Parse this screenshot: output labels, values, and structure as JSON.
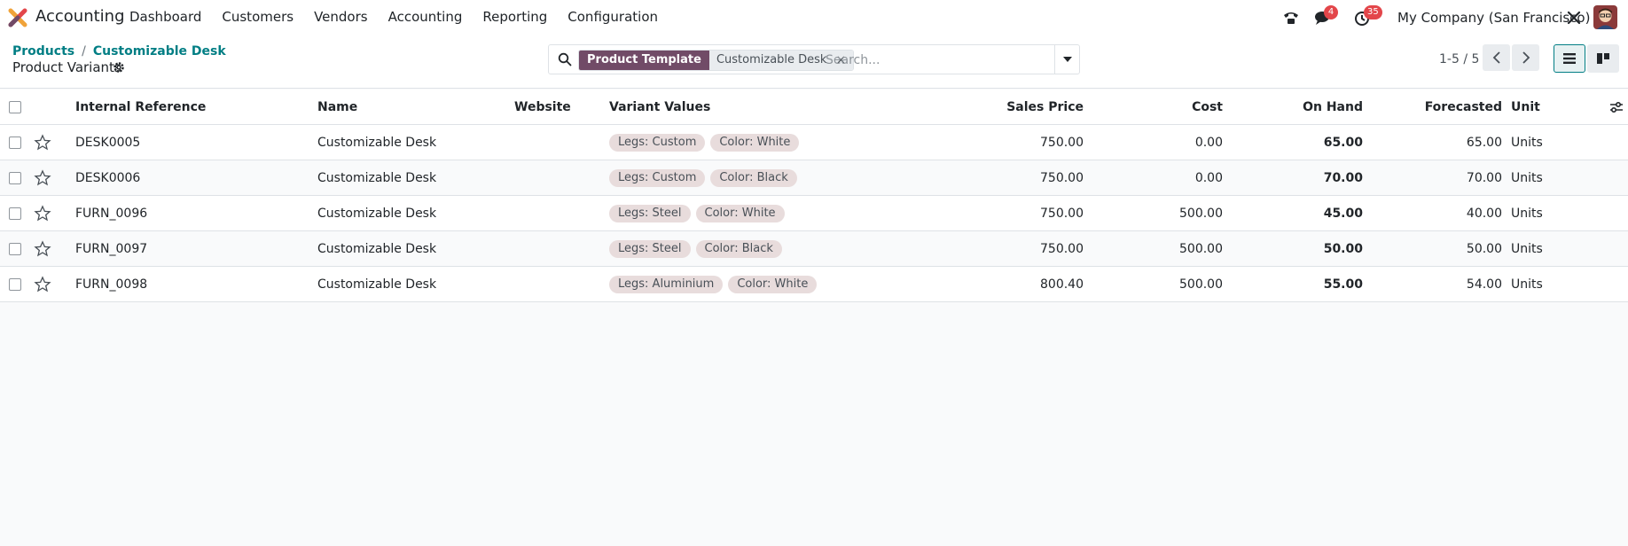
{
  "app": {
    "name": "Accounting"
  },
  "menu": [
    "Dashboard",
    "Customers",
    "Vendors",
    "Accounting",
    "Reporting",
    "Configuration"
  ],
  "systray": {
    "messages_count": "4",
    "activities_count": "35",
    "company": "My Company (San Francisco)"
  },
  "breadcrumb": {
    "parent": "Products",
    "current": "Customizable Desk",
    "separator": "/"
  },
  "page_title": "Product Variants",
  "search": {
    "facet_label": "Product Template",
    "facet_value": "Customizable Desk",
    "remove_symbol": "×",
    "placeholder": "Search..."
  },
  "pager": {
    "text": "1-5 / 5"
  },
  "table": {
    "headers": {
      "internal_ref": "Internal Reference",
      "name": "Name",
      "website": "Website",
      "variant_values": "Variant Values",
      "sales_price": "Sales Price",
      "cost": "Cost",
      "on_hand": "On Hand",
      "forecasted": "Forecasted",
      "unit": "Unit"
    },
    "rows": [
      {
        "ref": "DESK0005",
        "name": "Customizable Desk",
        "tags": [
          "Legs: Custom",
          "Color: White"
        ],
        "price": "750.00",
        "cost": "0.00",
        "on_hand": "65.00",
        "forecasted": "65.00",
        "unit": "Units"
      },
      {
        "ref": "DESK0006",
        "name": "Customizable Desk",
        "tags": [
          "Legs: Custom",
          "Color: Black"
        ],
        "price": "750.00",
        "cost": "0.00",
        "on_hand": "70.00",
        "forecasted": "70.00",
        "unit": "Units"
      },
      {
        "ref": "FURN_0096",
        "name": "Customizable Desk",
        "tags": [
          "Legs: Steel",
          "Color: White"
        ],
        "price": "750.00",
        "cost": "500.00",
        "on_hand": "45.00",
        "forecasted": "40.00",
        "unit": "Units"
      },
      {
        "ref": "FURN_0097",
        "name": "Customizable Desk",
        "tags": [
          "Legs: Steel",
          "Color: Black"
        ],
        "price": "750.00",
        "cost": "500.00",
        "on_hand": "50.00",
        "forecasted": "50.00",
        "unit": "Units"
      },
      {
        "ref": "FURN_0098",
        "name": "Customizable Desk",
        "tags": [
          "Legs: Aluminium",
          "Color: White"
        ],
        "price": "800.40",
        "cost": "500.00",
        "on_hand": "55.00",
        "forecasted": "54.00",
        "unit": "Units"
      }
    ]
  },
  "colors": {
    "brand": "#714b67",
    "link": "#017e84",
    "badge": "#e3464a",
    "tag_bg": "#e8dcdc"
  },
  "icons": [
    "app-logo-icon",
    "phone-icon",
    "chat-icon",
    "clock-icon",
    "tools-icon",
    "gear-icon",
    "search-icon",
    "caret-down-icon",
    "chevron-left-icon",
    "chevron-right-icon",
    "list-view-icon",
    "kanban-view-icon",
    "star-icon",
    "optional-columns-icon"
  ]
}
